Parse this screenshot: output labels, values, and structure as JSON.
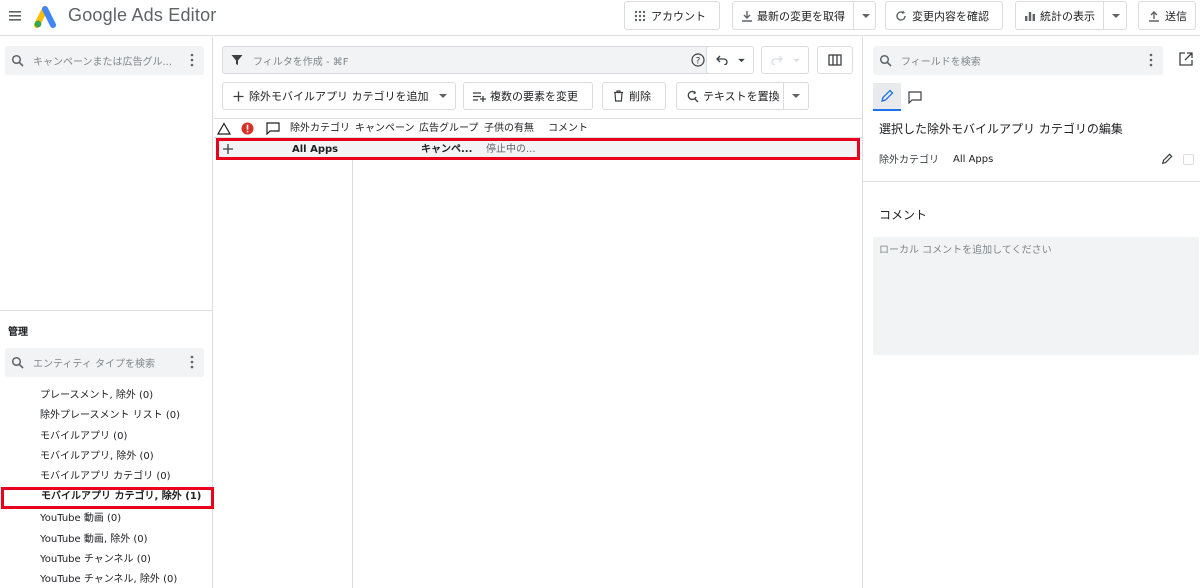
{
  "app": {
    "title": "Google Ads Editor"
  },
  "toolbar": {
    "account_label": "アカウント",
    "get_changes_label": "最新の変更を取得",
    "review_changes_label": "変更内容を確認",
    "stats_label": "統計の表示",
    "send_label": "送信"
  },
  "left": {
    "campaign_search_placeholder": "キャンペーンまたは広告グル...",
    "manage_label": "管理",
    "entity_search_placeholder": "エンティティ タイプを検索",
    "entities": [
      {
        "label": "プレースメント, 除外 (0)"
      },
      {
        "label": "除外プレースメント リスト (0)"
      },
      {
        "label": "モバイルアプリ (0)"
      },
      {
        "label": "モバイルアプリ, 除外 (0)"
      },
      {
        "label": "モバイルアプリ カテゴリ (0)"
      },
      {
        "label": "モバイルアプリ カテゴリ, 除外 (1)",
        "selected": true
      },
      {
        "label": "YouTube 動画 (0)"
      },
      {
        "label": "YouTube 動画, 除外 (0)"
      },
      {
        "label": "YouTube チャンネル (0)"
      },
      {
        "label": "YouTube チャンネル, 除外 (0)"
      }
    ]
  },
  "center": {
    "filter_placeholder": "フィルタを作成 - ⌘F",
    "add_button_label": "除外モバイルアプリ カテゴリを追加",
    "multi_change_label": "複数の要素を変更",
    "delete_label": "削除",
    "replace_text_label": "テキストを置換",
    "columns": [
      "除外カテゴリ",
      "キャンペーン",
      "広告グループ",
      "子供の有無",
      "コメント"
    ],
    "rows": [
      {
        "category": "All Apps",
        "campaign": "",
        "ad_group": "キャンペ...",
        "children": "停止中の..."
      }
    ]
  },
  "right": {
    "field_search_placeholder": "フィールドを検索",
    "edit_title": "選択した除外モバイルアプリ カテゴリの編集",
    "field_label": "除外カテゴリ",
    "field_value": "All Apps",
    "comment_title": "コメント",
    "comment_placeholder": "ローカル コメントを追加してください"
  },
  "colors": {
    "accent": "#1a73e8",
    "highlight": "#e8001c",
    "error": "#d93025"
  }
}
